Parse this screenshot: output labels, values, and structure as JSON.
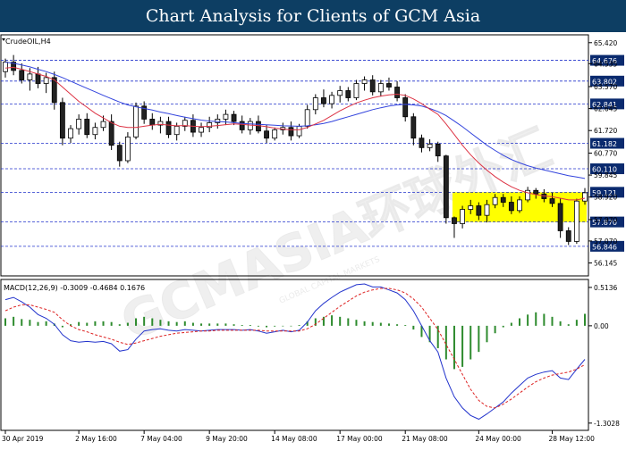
{
  "banner": {
    "title": "Chart Analysis for Clients of GCM Asia"
  },
  "watermark": {
    "text": "GCMASIA环球外汇",
    "subtext": "GLOBAL CAPITAL MARKETS"
  },
  "colors": {
    "banner_bg": "#0d3e63",
    "price_line": "#2233cc",
    "ma_fast": "#dd3344",
    "ma_slow": "#3344dd",
    "zone": "#ffff00",
    "macd_bar": "#2e8b2e",
    "macd_line": "#2233cc",
    "signal_line": "#dd2222",
    "bull": "#ffffff",
    "bear": "#222222"
  },
  "chart_data": [
    {
      "type": "candlestick",
      "title": "CrudeOIL,H4",
      "ylim": [
        55.6,
        65.75
      ],
      "y_ticks": [
        65.42,
        64.535,
        63.57,
        62.645,
        61.72,
        60.77,
        59.845,
        58.92,
        57.97,
        57.07,
        56.145
      ],
      "levels": [
        64.676,
        63.802,
        62.841,
        61.182,
        60.11,
        59.121,
        57.87,
        56.846
      ],
      "zone": {
        "from": 57.87,
        "to": 59.121,
        "start_index": 55,
        "end_index": 71
      },
      "x_tick_labels": [
        "30 Apr 2019",
        "2 May 16:00",
        "7 May 04:00",
        "9 May 20:00",
        "14 May 08:00",
        "17 May 00:00",
        "21 May 08:00",
        "24 May 00:00",
        "28 May 12:00"
      ],
      "x_tick_index": [
        0,
        9,
        17,
        25,
        33,
        41,
        49,
        58,
        67
      ],
      "ohlc": [
        [
          64.2,
          64.75,
          63.95,
          64.6
        ],
        [
          64.6,
          64.9,
          64.05,
          64.25
        ],
        [
          64.25,
          64.55,
          63.7,
          63.85
        ],
        [
          63.85,
          64.35,
          63.4,
          64.1
        ],
        [
          64.1,
          64.4,
          63.5,
          63.7
        ],
        [
          63.7,
          64.15,
          63.3,
          63.95
        ],
        [
          63.95,
          64.2,
          62.6,
          62.9
        ],
        [
          62.9,
          63.1,
          61.1,
          61.4
        ],
        [
          61.4,
          61.95,
          61.2,
          61.8
        ],
        [
          61.8,
          62.4,
          61.55,
          62.2
        ],
        [
          62.2,
          62.45,
          61.4,
          61.55
        ],
        [
          61.55,
          62.05,
          61.35,
          61.85
        ],
        [
          61.85,
          62.35,
          61.7,
          62.1
        ],
        [
          62.1,
          62.4,
          60.9,
          61.1
        ],
        [
          61.1,
          61.25,
          60.2,
          60.45
        ],
        [
          60.45,
          61.65,
          60.35,
          61.45
        ],
        [
          61.45,
          62.9,
          61.35,
          62.75
        ],
        [
          62.75,
          62.95,
          62.0,
          62.2
        ],
        [
          62.2,
          62.45,
          61.75,
          61.95
        ],
        [
          61.95,
          62.3,
          61.6,
          62.1
        ],
        [
          62.1,
          62.3,
          61.4,
          61.55
        ],
        [
          61.55,
          62.05,
          61.3,
          61.9
        ],
        [
          61.9,
          62.3,
          61.7,
          62.15
        ],
        [
          62.15,
          62.4,
          61.45,
          61.65
        ],
        [
          61.65,
          62.05,
          61.45,
          61.85
        ],
        [
          61.85,
          62.3,
          61.65,
          62.05
        ],
        [
          62.05,
          62.4,
          61.8,
          62.2
        ],
        [
          62.2,
          62.6,
          61.95,
          62.4
        ],
        [
          62.4,
          62.55,
          61.95,
          62.1
        ],
        [
          62.1,
          62.35,
          61.6,
          61.75
        ],
        [
          61.75,
          62.25,
          61.55,
          62.1
        ],
        [
          62.1,
          62.35,
          61.6,
          61.7
        ],
        [
          61.7,
          61.95,
          61.2,
          61.4
        ],
        [
          61.4,
          61.85,
          61.3,
          61.75
        ],
        [
          61.75,
          62.05,
          61.55,
          61.85
        ],
        [
          61.85,
          62.1,
          61.3,
          61.5
        ],
        [
          61.5,
          62.0,
          61.4,
          61.9
        ],
        [
          61.9,
          62.8,
          61.8,
          62.6
        ],
        [
          62.6,
          63.25,
          62.4,
          63.1
        ],
        [
          63.1,
          63.45,
          62.7,
          62.85
        ],
        [
          62.85,
          63.35,
          62.65,
          63.2
        ],
        [
          63.2,
          63.6,
          62.9,
          63.4
        ],
        [
          63.4,
          63.55,
          62.95,
          63.1
        ],
        [
          63.1,
          63.85,
          63.0,
          63.7
        ],
        [
          63.7,
          64.0,
          63.4,
          63.85
        ],
        [
          63.85,
          64.05,
          63.2,
          63.35
        ],
        [
          63.35,
          63.85,
          63.15,
          63.7
        ],
        [
          63.7,
          63.95,
          63.4,
          63.55
        ],
        [
          63.55,
          63.8,
          62.95,
          63.1
        ],
        [
          63.1,
          63.25,
          62.1,
          62.3
        ],
        [
          62.3,
          62.45,
          61.1,
          61.4
        ],
        [
          61.4,
          61.55,
          60.8,
          61.0
        ],
        [
          61.0,
          61.35,
          60.85,
          61.15
        ],
        [
          61.15,
          61.25,
          60.4,
          60.65
        ],
        [
          60.65,
          60.7,
          57.8,
          58.05
        ],
        [
          58.05,
          58.1,
          57.2,
          57.8
        ],
        [
          57.8,
          58.55,
          57.6,
          58.4
        ],
        [
          58.4,
          58.8,
          58.2,
          58.55
        ],
        [
          58.55,
          58.7,
          57.95,
          58.15
        ],
        [
          58.15,
          58.8,
          57.85,
          58.6
        ],
        [
          58.6,
          59.05,
          58.45,
          58.9
        ],
        [
          58.9,
          59.05,
          58.5,
          58.7
        ],
        [
          58.7,
          58.95,
          58.2,
          58.35
        ],
        [
          58.35,
          58.95,
          58.25,
          58.8
        ],
        [
          58.8,
          59.35,
          58.7,
          59.2
        ],
        [
          59.2,
          59.3,
          58.85,
          59.05
        ],
        [
          59.05,
          59.25,
          58.7,
          58.85
        ],
        [
          58.85,
          59.1,
          58.5,
          58.65
        ],
        [
          58.65,
          58.85,
          57.2,
          57.5
        ],
        [
          57.5,
          57.65,
          56.9,
          57.05
        ],
        [
          57.05,
          58.85,
          56.95,
          58.75
        ],
        [
          58.75,
          59.3,
          58.6,
          59.1
        ]
      ],
      "ma_fast": [
        64.35,
        64.38,
        64.3,
        64.2,
        64.1,
        64.0,
        63.85,
        63.55,
        63.25,
        62.95,
        62.7,
        62.45,
        62.25,
        62.05,
        61.9,
        61.85,
        61.85,
        61.9,
        61.95,
        61.98,
        61.95,
        61.92,
        61.93,
        61.9,
        61.88,
        61.9,
        61.93,
        61.97,
        62.0,
        61.98,
        61.95,
        61.93,
        61.88,
        61.82,
        61.78,
        61.75,
        61.75,
        61.85,
        62.0,
        62.15,
        62.35,
        62.55,
        62.72,
        62.88,
        63.0,
        63.1,
        63.17,
        63.22,
        63.25,
        63.2,
        63.05,
        62.85,
        62.62,
        62.4,
        62.0,
        61.55,
        61.1,
        60.7,
        60.35,
        60.05,
        59.78,
        59.55,
        59.35,
        59.2,
        59.1,
        59.02,
        58.97,
        58.93,
        58.87,
        58.8,
        58.8,
        58.87
      ],
      "ma_slow": [
        64.6,
        64.55,
        64.48,
        64.4,
        64.3,
        64.2,
        64.08,
        63.95,
        63.8,
        63.65,
        63.5,
        63.35,
        63.2,
        63.06,
        62.92,
        62.8,
        62.72,
        62.65,
        62.58,
        62.5,
        62.43,
        62.35,
        62.28,
        62.22,
        62.16,
        62.12,
        62.1,
        62.08,
        62.05,
        62.02,
        62.0,
        61.98,
        61.96,
        61.94,
        61.92,
        61.91,
        61.9,
        61.92,
        61.96,
        62.02,
        62.1,
        62.2,
        62.3,
        62.4,
        62.5,
        62.6,
        62.68,
        62.75,
        62.8,
        62.82,
        62.8,
        62.75,
        62.65,
        62.52,
        62.35,
        62.12,
        61.88,
        61.62,
        61.36,
        61.1,
        60.88,
        60.68,
        60.5,
        60.36,
        60.24,
        60.14,
        60.06,
        59.98,
        59.9,
        59.82,
        59.76,
        59.7
      ]
    },
    {
      "type": "bar",
      "title": "MACD(12,26,9) -0.3009 -0.4684 0.1676",
      "ylim": [
        -1.4,
        0.62
      ],
      "y_ticks": [
        0.5136,
        0.0,
        -1.3028
      ],
      "histogram": [
        0.1,
        0.12,
        0.09,
        0.08,
        0.05,
        0.06,
        0.03,
        -0.02,
        0.02,
        0.05,
        0.04,
        0.06,
        0.06,
        0.05,
        0.02,
        0.04,
        0.1,
        0.12,
        0.1,
        0.08,
        0.06,
        0.05,
        0.06,
        0.04,
        0.03,
        0.03,
        0.03,
        0.03,
        0.02,
        0.01,
        0.01,
        -0.01,
        -0.02,
        -0.01,
        0.0,
        0.0,
        0.01,
        0.06,
        0.1,
        0.12,
        0.14,
        0.12,
        0.1,
        0.08,
        0.06,
        0.05,
        0.04,
        0.03,
        0.02,
        0.01,
        -0.05,
        -0.15,
        -0.22,
        -0.3,
        -0.45,
        -0.58,
        -0.55,
        -0.45,
        -0.35,
        -0.22,
        -0.1,
        -0.02,
        0.04,
        0.1,
        0.15,
        0.18,
        0.16,
        0.12,
        0.06,
        0.02,
        0.08,
        0.16
      ],
      "macd": [
        0.35,
        0.38,
        0.32,
        0.25,
        0.15,
        0.1,
        0.02,
        -0.12,
        -0.2,
        -0.22,
        -0.21,
        -0.22,
        -0.21,
        -0.24,
        -0.34,
        -0.32,
        -0.18,
        -0.07,
        -0.05,
        -0.04,
        -0.06,
        -0.07,
        -0.05,
        -0.06,
        -0.07,
        -0.06,
        -0.05,
        -0.05,
        -0.05,
        -0.06,
        -0.05,
        -0.07,
        -0.1,
        -0.08,
        -0.06,
        -0.08,
        -0.06,
        0.05,
        0.2,
        0.3,
        0.38,
        0.45,
        0.5,
        0.55,
        0.56,
        0.52,
        0.52,
        0.48,
        0.44,
        0.35,
        0.2,
        0.0,
        -0.2,
        -0.35,
        -0.7,
        -0.95,
        -1.1,
        -1.2,
        -1.25,
        -1.18,
        -1.1,
        -1.02,
        -0.9,
        -0.8,
        -0.7,
        -0.65,
        -0.62,
        -0.6,
        -0.7,
        -0.72,
        -0.58,
        -0.45
      ],
      "signal": [
        0.2,
        0.25,
        0.28,
        0.28,
        0.25,
        0.22,
        0.18,
        0.08,
        0.0,
        -0.05,
        -0.08,
        -0.12,
        -0.15,
        -0.18,
        -0.22,
        -0.25,
        -0.23,
        -0.2,
        -0.17,
        -0.14,
        -0.12,
        -0.1,
        -0.09,
        -0.08,
        -0.07,
        -0.07,
        -0.06,
        -0.06,
        -0.06,
        -0.06,
        -0.06,
        -0.06,
        -0.07,
        -0.07,
        -0.07,
        -0.07,
        -0.07,
        -0.04,
        0.02,
        0.1,
        0.18,
        0.26,
        0.33,
        0.4,
        0.45,
        0.48,
        0.5,
        0.5,
        0.48,
        0.44,
        0.36,
        0.25,
        0.1,
        -0.05,
        -0.25,
        -0.45,
        -0.65,
        -0.85,
        -1.0,
        -1.08,
        -1.1,
        -1.05,
        -0.98,
        -0.9,
        -0.82,
        -0.75,
        -0.7,
        -0.66,
        -0.64,
        -0.62,
        -0.58,
        -0.52
      ]
    }
  ]
}
